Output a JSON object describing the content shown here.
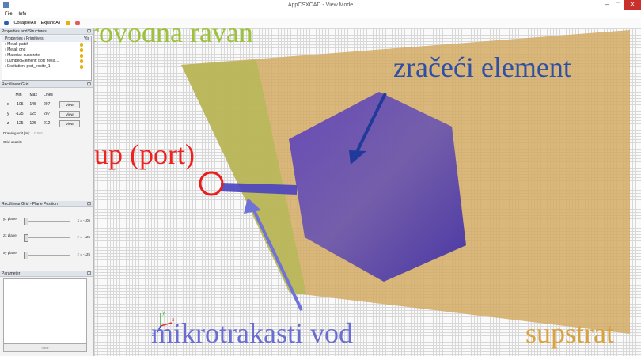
{
  "window": {
    "title": "AppCSXCAD - View Mode"
  },
  "menu": [
    "File",
    "Info"
  ],
  "toolbar": {
    "collapse": "CollapseAll",
    "expand": "ExpandAll"
  },
  "structures": {
    "title": "Properties and Structures",
    "header": "Properties / Primitives",
    "vis_col": "Vis",
    "items": [
      "Metal: patch",
      "Metal: gnd",
      "Material: substrate",
      "LumpedElement: port_resis...",
      "Excitation: port_excite_1"
    ]
  },
  "rect_grid": {
    "title": "Rectilinear Grid",
    "headers": [
      "Min",
      "Max",
      "Lines"
    ],
    "rows": [
      {
        "axis": "x",
        "min": "-105",
        "max": "145",
        "lines": "207",
        "btn": "View"
      },
      {
        "axis": "y",
        "min": "-125",
        "max": "125",
        "lines": "207",
        "btn": "View"
      },
      {
        "axis": "z",
        "min": "-125",
        "max": "125",
        "lines": "212",
        "btn": "View"
      }
    ],
    "drawing_unit_label": "Drawing unit [m]:",
    "drawing_unit_value": "0.001",
    "grid_opacity_label": "Grid opacity"
  },
  "plane_pos": {
    "title": "Rectilinear Grid - Plane Position",
    "rows": [
      {
        "label": "yz plane:",
        "value": "x = -105"
      },
      {
        "label": "zx plane:",
        "value": "y = -125"
      },
      {
        "label": "xy plane:",
        "value": "z = -125"
      }
    ]
  },
  "parameter": {
    "title": "Parameter",
    "new_btn": "New"
  },
  "annotations": {
    "ground": "provodna ravan",
    "patch": "zračeći element",
    "port": "pristup (port)",
    "feed": "mikrotrakasti vod",
    "substrate": "supstrat"
  },
  "colors": {
    "ground_label": "#9dc13a",
    "patch_label": "#2e4fa8",
    "port_label": "#ee2020",
    "feed_label": "#6a6ed2",
    "substrate_label": "#d9a23f"
  }
}
